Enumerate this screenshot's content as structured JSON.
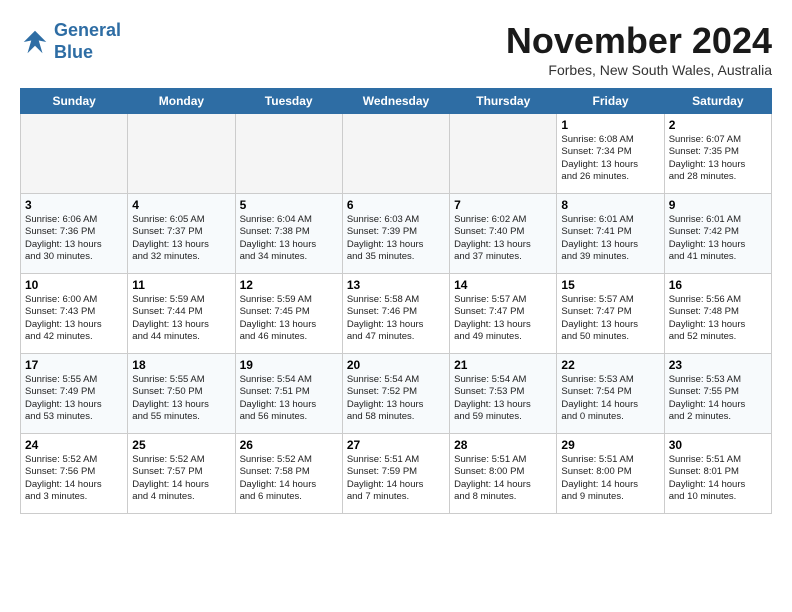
{
  "logo": {
    "line1": "General",
    "line2": "Blue"
  },
  "title": "November 2024",
  "location": "Forbes, New South Wales, Australia",
  "headers": [
    "Sunday",
    "Monday",
    "Tuesday",
    "Wednesday",
    "Thursday",
    "Friday",
    "Saturday"
  ],
  "weeks": [
    [
      {
        "day": "",
        "info": "",
        "empty": true
      },
      {
        "day": "",
        "info": "",
        "empty": true
      },
      {
        "day": "",
        "info": "",
        "empty": true
      },
      {
        "day": "",
        "info": "",
        "empty": true
      },
      {
        "day": "",
        "info": "",
        "empty": true
      },
      {
        "day": "1",
        "info": "Sunrise: 6:08 AM\nSunset: 7:34 PM\nDaylight: 13 hours\nand 26 minutes.",
        "empty": false
      },
      {
        "day": "2",
        "info": "Sunrise: 6:07 AM\nSunset: 7:35 PM\nDaylight: 13 hours\nand 28 minutes.",
        "empty": false
      }
    ],
    [
      {
        "day": "3",
        "info": "Sunrise: 6:06 AM\nSunset: 7:36 PM\nDaylight: 13 hours\nand 30 minutes.",
        "empty": false
      },
      {
        "day": "4",
        "info": "Sunrise: 6:05 AM\nSunset: 7:37 PM\nDaylight: 13 hours\nand 32 minutes.",
        "empty": false
      },
      {
        "day": "5",
        "info": "Sunrise: 6:04 AM\nSunset: 7:38 PM\nDaylight: 13 hours\nand 34 minutes.",
        "empty": false
      },
      {
        "day": "6",
        "info": "Sunrise: 6:03 AM\nSunset: 7:39 PM\nDaylight: 13 hours\nand 35 minutes.",
        "empty": false
      },
      {
        "day": "7",
        "info": "Sunrise: 6:02 AM\nSunset: 7:40 PM\nDaylight: 13 hours\nand 37 minutes.",
        "empty": false
      },
      {
        "day": "8",
        "info": "Sunrise: 6:01 AM\nSunset: 7:41 PM\nDaylight: 13 hours\nand 39 minutes.",
        "empty": false
      },
      {
        "day": "9",
        "info": "Sunrise: 6:01 AM\nSunset: 7:42 PM\nDaylight: 13 hours\nand 41 minutes.",
        "empty": false
      }
    ],
    [
      {
        "day": "10",
        "info": "Sunrise: 6:00 AM\nSunset: 7:43 PM\nDaylight: 13 hours\nand 42 minutes.",
        "empty": false
      },
      {
        "day": "11",
        "info": "Sunrise: 5:59 AM\nSunset: 7:44 PM\nDaylight: 13 hours\nand 44 minutes.",
        "empty": false
      },
      {
        "day": "12",
        "info": "Sunrise: 5:59 AM\nSunset: 7:45 PM\nDaylight: 13 hours\nand 46 minutes.",
        "empty": false
      },
      {
        "day": "13",
        "info": "Sunrise: 5:58 AM\nSunset: 7:46 PM\nDaylight: 13 hours\nand 47 minutes.",
        "empty": false
      },
      {
        "day": "14",
        "info": "Sunrise: 5:57 AM\nSunset: 7:47 PM\nDaylight: 13 hours\nand 49 minutes.",
        "empty": false
      },
      {
        "day": "15",
        "info": "Sunrise: 5:57 AM\nSunset: 7:47 PM\nDaylight: 13 hours\nand 50 minutes.",
        "empty": false
      },
      {
        "day": "16",
        "info": "Sunrise: 5:56 AM\nSunset: 7:48 PM\nDaylight: 13 hours\nand 52 minutes.",
        "empty": false
      }
    ],
    [
      {
        "day": "17",
        "info": "Sunrise: 5:55 AM\nSunset: 7:49 PM\nDaylight: 13 hours\nand 53 minutes.",
        "empty": false
      },
      {
        "day": "18",
        "info": "Sunrise: 5:55 AM\nSunset: 7:50 PM\nDaylight: 13 hours\nand 55 minutes.",
        "empty": false
      },
      {
        "day": "19",
        "info": "Sunrise: 5:54 AM\nSunset: 7:51 PM\nDaylight: 13 hours\nand 56 minutes.",
        "empty": false
      },
      {
        "day": "20",
        "info": "Sunrise: 5:54 AM\nSunset: 7:52 PM\nDaylight: 13 hours\nand 58 minutes.",
        "empty": false
      },
      {
        "day": "21",
        "info": "Sunrise: 5:54 AM\nSunset: 7:53 PM\nDaylight: 13 hours\nand 59 minutes.",
        "empty": false
      },
      {
        "day": "22",
        "info": "Sunrise: 5:53 AM\nSunset: 7:54 PM\nDaylight: 14 hours\nand 0 minutes.",
        "empty": false
      },
      {
        "day": "23",
        "info": "Sunrise: 5:53 AM\nSunset: 7:55 PM\nDaylight: 14 hours\nand 2 minutes.",
        "empty": false
      }
    ],
    [
      {
        "day": "24",
        "info": "Sunrise: 5:52 AM\nSunset: 7:56 PM\nDaylight: 14 hours\nand 3 minutes.",
        "empty": false
      },
      {
        "day": "25",
        "info": "Sunrise: 5:52 AM\nSunset: 7:57 PM\nDaylight: 14 hours\nand 4 minutes.",
        "empty": false
      },
      {
        "day": "26",
        "info": "Sunrise: 5:52 AM\nSunset: 7:58 PM\nDaylight: 14 hours\nand 6 minutes.",
        "empty": false
      },
      {
        "day": "27",
        "info": "Sunrise: 5:51 AM\nSunset: 7:59 PM\nDaylight: 14 hours\nand 7 minutes.",
        "empty": false
      },
      {
        "day": "28",
        "info": "Sunrise: 5:51 AM\nSunset: 8:00 PM\nDaylight: 14 hours\nand 8 minutes.",
        "empty": false
      },
      {
        "day": "29",
        "info": "Sunrise: 5:51 AM\nSunset: 8:00 PM\nDaylight: 14 hours\nand 9 minutes.",
        "empty": false
      },
      {
        "day": "30",
        "info": "Sunrise: 5:51 AM\nSunset: 8:01 PM\nDaylight: 14 hours\nand 10 minutes.",
        "empty": false
      }
    ]
  ]
}
